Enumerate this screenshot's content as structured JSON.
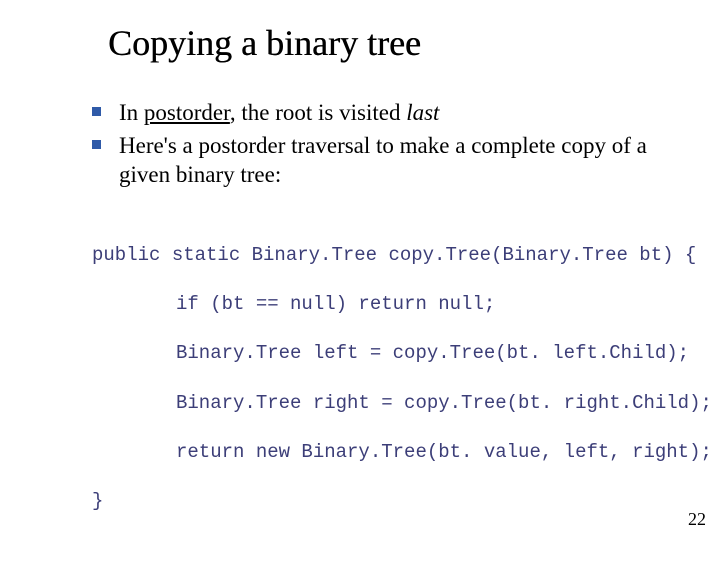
{
  "title": "Copying a binary tree",
  "bullets": [
    {
      "pre": "In ",
      "u": "postorder",
      "mid": ", the root is visited ",
      "it": "last",
      "post": ""
    },
    {
      "pre": "Here's a postorder traversal to make a complete copy of a given binary tree:",
      "u": "",
      "mid": "",
      "it": "",
      "post": ""
    }
  ],
  "code": {
    "l0": "public static Binary.Tree copy.Tree(Binary.Tree bt) {",
    "l1": "if (bt == null) return null;",
    "l2": "Binary.Tree left = copy.Tree(bt. left.Child);",
    "l3": "Binary.Tree right = copy.Tree(bt. right.Child);",
    "l4": "return new Binary.Tree(bt. value, left, right);",
    "l5": "}"
  },
  "page_number": "22"
}
